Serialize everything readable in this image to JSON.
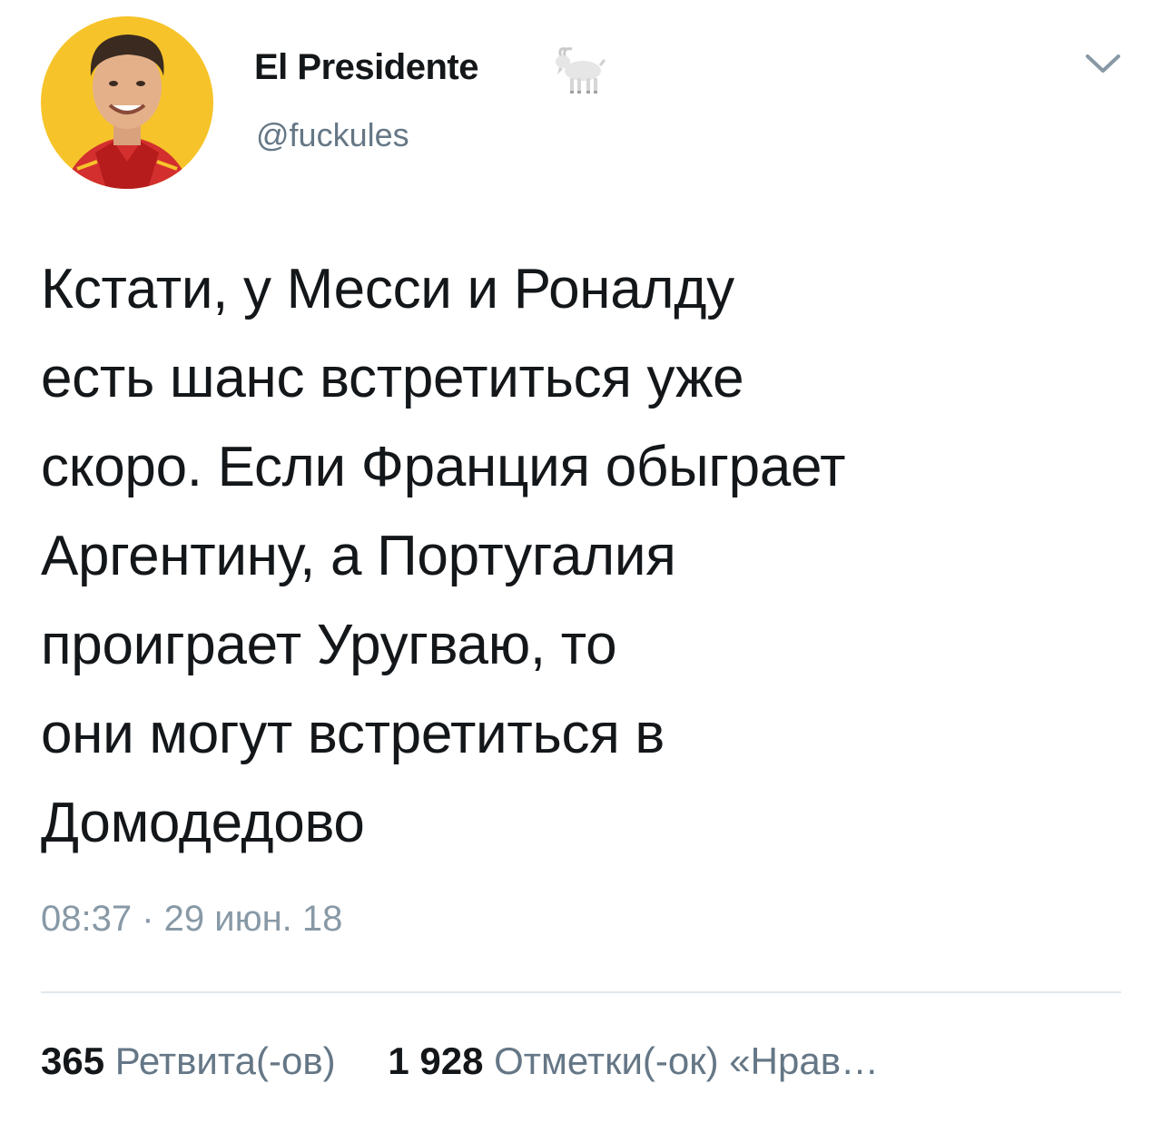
{
  "tweet": {
    "author": {
      "display_name": "El Presidente",
      "handle": "@fuckules",
      "name_icon": "goat-icon"
    },
    "menu_icon": "chevron-down-icon",
    "text": "Кстати, у Месси и Роналду\nесть шанс встретиться уже\nскоро. Если Франция обыграет\nАргентину, а Португалия\nпроиграет Уругваю, то\nони могут встретиться в\nДомодедово",
    "timestamp": "08:37 · 29 июн. 18",
    "stats": {
      "retweets_count": "365",
      "retweets_label": "Ретвита(-ов)",
      "likes_count": "1 928",
      "likes_label": "Отметки(-ок) «Нрав…"
    }
  },
  "colors": {
    "text_primary": "#14171a",
    "text_secondary": "#657786",
    "timestamp": "#8899a6",
    "divider": "#e1e8ed",
    "avatar_background": "#f6c42a"
  }
}
